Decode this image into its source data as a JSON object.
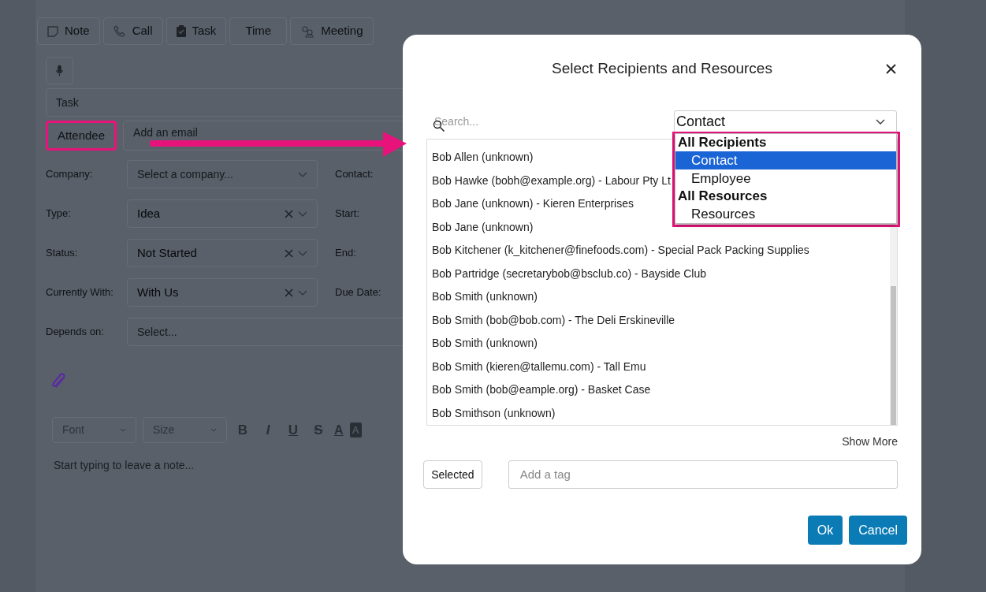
{
  "app": {
    "tabs": [
      {
        "label": "Note"
      },
      {
        "label": "Call"
      },
      {
        "label": "Task"
      },
      {
        "label": "Time"
      },
      {
        "label": "Meeting"
      }
    ],
    "title_field": {
      "placeholder": "Task"
    },
    "attendee_button": "Attendee",
    "email_field": {
      "placeholder": "Add an email"
    },
    "fields": [
      {
        "label": "Company:",
        "placeholder": "Select a company...",
        "clearable": false,
        "side_label": "Contact:",
        "kind": "select"
      },
      {
        "label": "Type:",
        "value": "Idea",
        "clearable": true,
        "side_label": "Start:",
        "kind": "select"
      },
      {
        "label": "Status:",
        "value": "Not Started",
        "clearable": true,
        "side_label": "End:",
        "kind": "select"
      },
      {
        "label": "Currently With:",
        "value": "With Us",
        "clearable": true,
        "side_label": "Due Date:",
        "kind": "select"
      },
      {
        "label": "Depends on:",
        "placeholder": "Select...",
        "kind": "wide"
      }
    ],
    "editor": {
      "font": "Font",
      "size": "Size",
      "format_buttons": [
        "B",
        "I",
        "U",
        "S"
      ],
      "color_buttons": [
        "A",
        "A"
      ],
      "placeholder": "Start typing to leave a note..."
    }
  },
  "dialog": {
    "title": "Select Recipients and Resources",
    "search": {
      "placeholder": "Search..."
    },
    "filter": {
      "value": "Contact",
      "open": true,
      "options": [
        {
          "label": "All Recipients",
          "kind": "group"
        },
        {
          "label": "Contact",
          "kind": "option",
          "selected": true
        },
        {
          "label": "Employee",
          "kind": "option",
          "selected": false
        },
        {
          "label": "All Resources",
          "kind": "group"
        },
        {
          "label": "Resources",
          "kind": "option",
          "selected": false
        }
      ]
    },
    "recipients": [
      "Bob Allen (unknown)",
      "Bob Hawke (bobh@example.org) - Labour Pty Lt",
      "Bob Jane (unknown) - Kieren Enterprises",
      "Bob Jane (unknown)",
      "Bob Kitchener (k_kitchener@finefoods.com) - Special Pack Packing Supplies",
      "Bob Partridge (secretarybob@bsclub.co) - Bayside Club",
      "Bob Smith (unknown)",
      "Bob Smith (bob@bob.com) - The Deli Erskineville",
      "Bob Smith (unknown)",
      "Bob Smith (kieren@tallemu.com) - Tall Emu",
      "Bob Smith (bob@eample.org) - Basket Case",
      "Bob Smithson (unknown)"
    ],
    "show_more": "Show More",
    "selected_button": "Selected",
    "tag_field": {
      "placeholder": "Add a tag"
    },
    "buttons": [
      {
        "label": "Ok"
      },
      {
        "label": "Cancel"
      }
    ]
  }
}
